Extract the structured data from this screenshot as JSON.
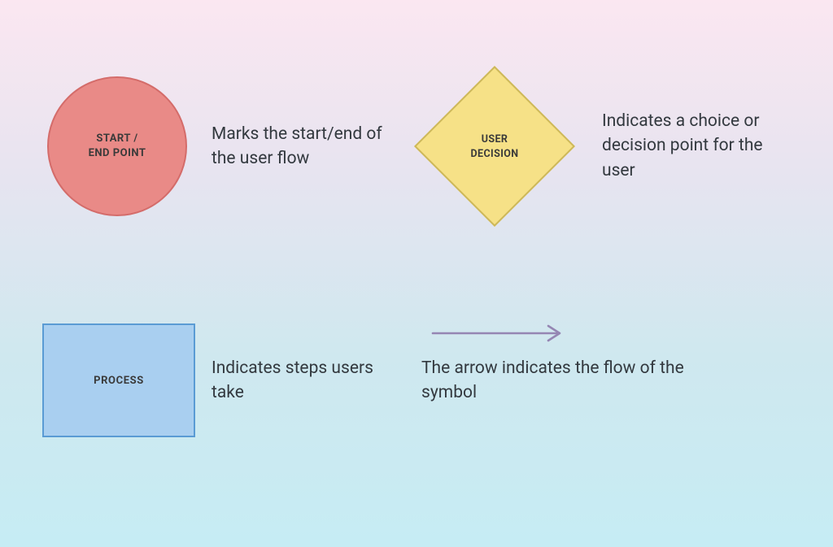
{
  "legend": {
    "startEnd": {
      "label": "START /\nEND POINT",
      "description": "Marks the start/end of the user flow"
    },
    "decision": {
      "label": "USER\nDECISION",
      "description": "Indicates a choice or decision point for the user"
    },
    "process": {
      "label": "PROCESS",
      "description": "Indicates steps users take"
    },
    "arrow": {
      "description": "The arrow indicates the flow of the symbol"
    }
  },
  "colors": {
    "circleFill": "#e98a87",
    "circleStroke": "#d46c6a",
    "diamondFill": "#f6e187",
    "diamondStroke": "#cdb85a",
    "rectFill": "#a9cff0",
    "rectStroke": "#5a9bd4",
    "arrow": "#9586b3"
  }
}
